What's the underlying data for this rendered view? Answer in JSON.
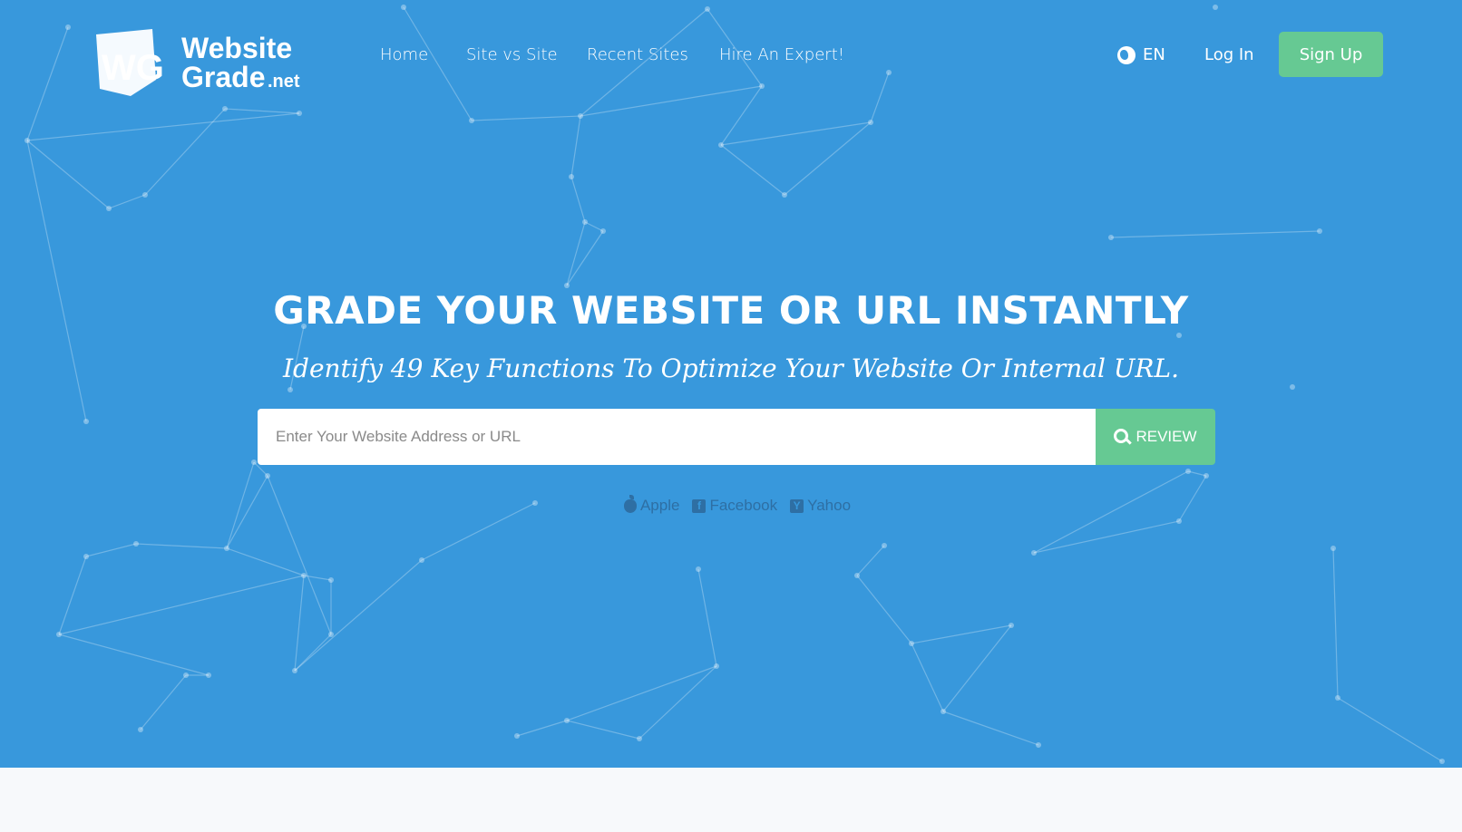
{
  "brand": {
    "line1": "Website",
    "line2": "Grade",
    "suffix": ".net",
    "monogram": "WG"
  },
  "nav": {
    "items": [
      {
        "label": "Home"
      },
      {
        "label": "Site vs Site"
      },
      {
        "label": "Recent Sites"
      },
      {
        "label": "Hire An Expert!"
      }
    ],
    "language": "EN",
    "login": "Log In",
    "signup": "Sign Up"
  },
  "hero": {
    "headline": "GRADE YOUR WEBSITE OR URL INSTANTLY",
    "subline": "Identify 49 Key Functions To Optimize Your Website Or Internal URL.",
    "search": {
      "placeholder": "Enter Your Website Address or URL",
      "value": "",
      "button": "REVIEW"
    },
    "examples": [
      {
        "label": "Apple",
        "icon": "apple-icon"
      },
      {
        "label": "Facebook",
        "icon": "facebook-icon"
      },
      {
        "label": "Yahoo",
        "icon": "yahoo-icon"
      }
    ]
  },
  "colors": {
    "hero_bg": "#3898dc",
    "accent": "#66c993",
    "example_text": "#2e6fa4",
    "page_bg": "#f7f9fb"
  }
}
